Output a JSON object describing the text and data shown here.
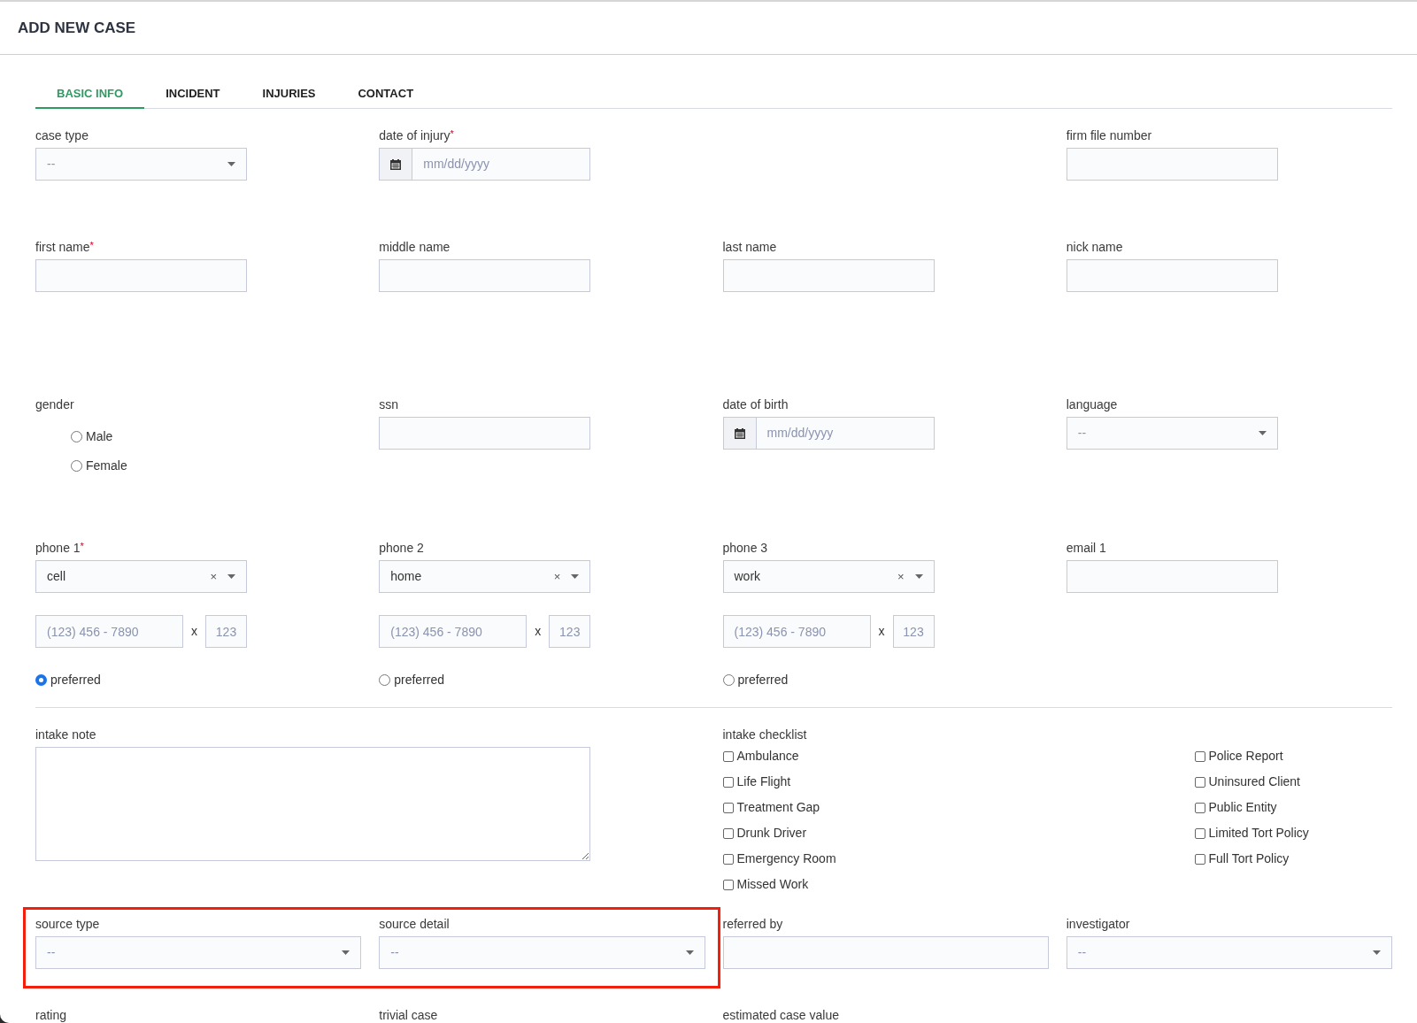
{
  "title": "ADD NEW CASE",
  "tabs": [
    {
      "label": "BASIC INFO",
      "selected": true
    },
    {
      "label": "INCIDENT",
      "selected": false
    },
    {
      "label": "INJURIES",
      "selected": false
    },
    {
      "label": "CONTACT",
      "selected": false
    }
  ],
  "row_1": [
    {
      "kind": "select",
      "label": "case type",
      "value": "--"
    },
    {
      "kind": "date",
      "label": "date of injury",
      "required_mark": "*",
      "placeholder": "mm/dd/yyyy"
    },
    {
      "kind": "text",
      "label": "firm file number"
    }
  ],
  "row_2": [
    {
      "kind": "text",
      "label": "first name",
      "required_mark": "*"
    },
    {
      "kind": "text",
      "label": "middle name"
    },
    {
      "kind": "text",
      "label": "last name"
    },
    {
      "kind": "text",
      "label": "nick name"
    }
  ],
  "row_3": [
    {
      "kind": "radio",
      "label": "gender",
      "options": [
        {
          "label": "Male",
          "selected": false
        },
        {
          "label": "Female",
          "selected": false
        }
      ]
    },
    {
      "kind": "text",
      "label": "ssn"
    },
    {
      "kind": "date",
      "label": "date of birth",
      "placeholder": "mm/dd/yyyy"
    },
    {
      "kind": "select",
      "label": "language",
      "value": "--"
    }
  ],
  "row_4": [
    {
      "kind": "phone",
      "label": "phone 1",
      "required_mark": "*",
      "type": "cell",
      "clear": "×",
      "number_placeholder": "(123) 456 - 7890",
      "separator": "x",
      "ext_placeholder": "123",
      "preferred_label": "preferred",
      "preferred": true
    },
    {
      "kind": "phone",
      "label": "phone 2",
      "type": "home",
      "clear": "×",
      "number_placeholder": "(123) 456 - 7890",
      "separator": "x",
      "ext_placeholder": "123",
      "preferred_label": "preferred",
      "preferred": false
    },
    {
      "kind": "phone",
      "label": "phone 3",
      "type": "work",
      "clear": "×",
      "number_placeholder": "(123) 456 - 7890",
      "separator": "x",
      "ext_placeholder": "123",
      "preferred_label": "preferred",
      "preferred": false
    },
    {
      "kind": "text",
      "label": "email 1"
    }
  ],
  "intake_note": {
    "label": "intake note"
  },
  "intake_checklist": {
    "label": "intake checklist",
    "columns": [
      [
        {
          "label": "Ambulance",
          "checked": false
        },
        {
          "label": "Life Flight",
          "checked": false
        },
        {
          "label": "Treatment Gap",
          "checked": false
        },
        {
          "label": "Drunk Driver",
          "checked": false
        },
        {
          "label": "Emergency Room",
          "checked": false
        },
        {
          "label": "Missed Work",
          "checked": false
        }
      ],
      [
        {
          "label": "Police Report",
          "checked": false
        },
        {
          "label": "Uninsured Client",
          "checked": false
        },
        {
          "label": "Public Entity",
          "checked": false
        },
        {
          "label": "Limited Tort Policy",
          "checked": false
        },
        {
          "label": "Full Tort Policy",
          "checked": false
        }
      ]
    ]
  },
  "source_group": {
    "highlighted": true,
    "fields": [
      {
        "kind": "select",
        "label": "source type",
        "value": "--"
      },
      {
        "kind": "select",
        "label": "source detail",
        "value": "--"
      }
    ]
  },
  "row_6": [
    {
      "kind": "text",
      "label": "referred by"
    },
    {
      "kind": "select",
      "label": "investigator",
      "value": "--"
    }
  ],
  "row_7": [
    {
      "label": "rating"
    },
    {
      "label": "trivial case"
    },
    {
      "label": "estimated case value"
    }
  ]
}
